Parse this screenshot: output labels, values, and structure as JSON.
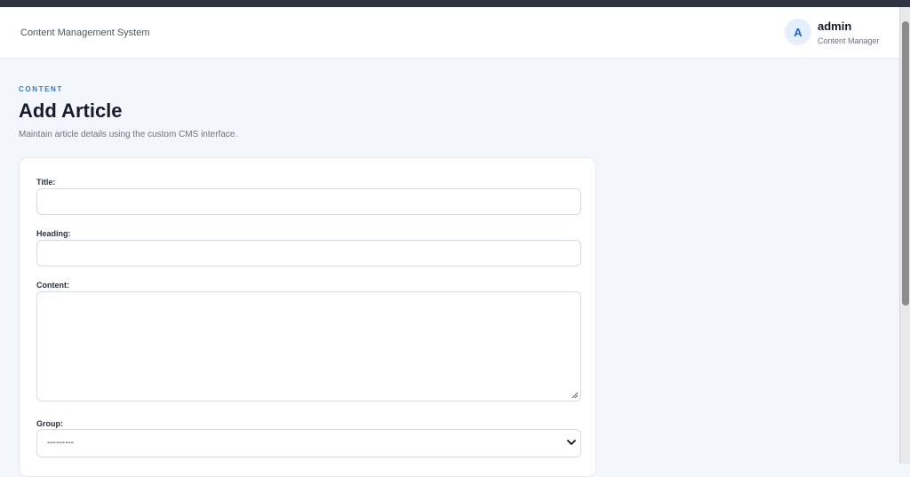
{
  "header": {
    "system_title": "Content Management System",
    "user": {
      "avatar_initial": "A",
      "name": "admin",
      "role": "Content Manager"
    }
  },
  "page": {
    "eyebrow": "CONTENT",
    "title": "Add Article",
    "description": "Maintain article details using the custom CMS interface."
  },
  "form": {
    "fields": {
      "title": {
        "label": "Title:",
        "value": ""
      },
      "heading": {
        "label": "Heading:",
        "value": ""
      },
      "content": {
        "label": "Content:",
        "value": ""
      },
      "group": {
        "label": "Group:",
        "selected": "---------"
      }
    }
  },
  "colors": {
    "accent": "#2f7ad6",
    "avatar_bg": "#e4eefc",
    "page_bg": "#f3f6fa"
  },
  "icons": {
    "select_arrow": "chevron-down-icon",
    "textarea_resize": "resize-handle-icon"
  }
}
